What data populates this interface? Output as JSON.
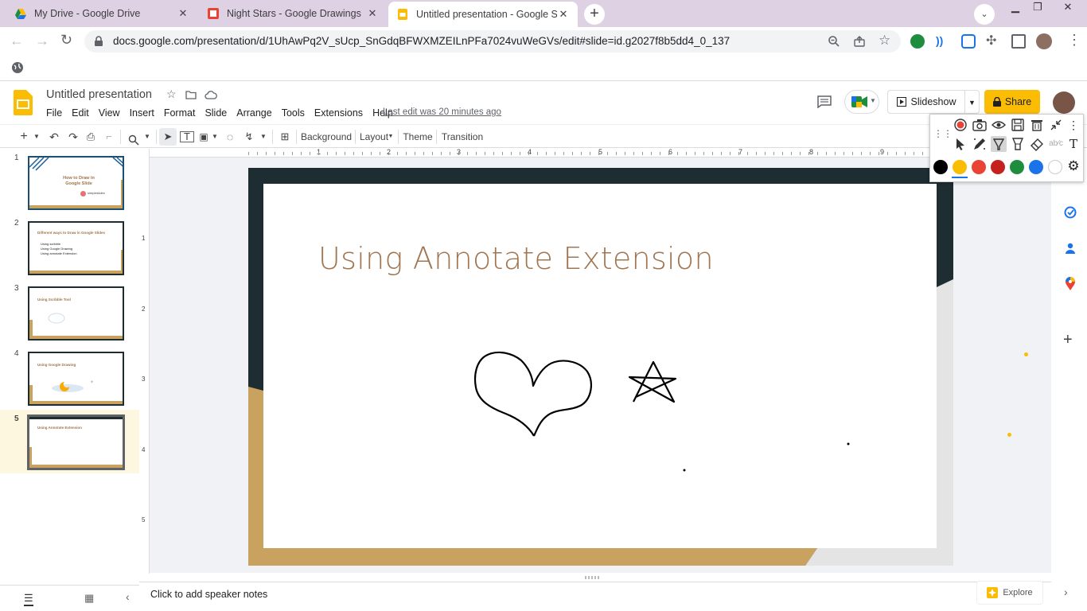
{
  "browser": {
    "tabs": [
      {
        "label": "My Drive - Google Drive",
        "icon": "google-drive-icon"
      },
      {
        "label": "Night Stars - Google Drawings",
        "icon": "google-drawings-icon"
      },
      {
        "label": "Untitled presentation - Google Sl",
        "icon": "google-slides-icon",
        "active": true
      }
    ],
    "new_tab": "+",
    "url": "docs.google.com/presentation/d/1UhAwPq2V_sUcp_SnGdqBFWXMZEILnPFa7024vuWeGVs/edit#slide=id.g2027f8b5dd4_0_137"
  },
  "app": {
    "doc_title": "Untitled presentation",
    "menus": [
      "File",
      "Edit",
      "View",
      "Insert",
      "Format",
      "Slide",
      "Arrange",
      "Tools",
      "Extensions",
      "Help"
    ],
    "last_edit": "Last edit was 20 minutes ago",
    "slideshow_label": "Slideshow",
    "share_label": "Share"
  },
  "toolbar": {
    "background": "Background",
    "layout": "Layout",
    "theme": "Theme",
    "transition": "Transition"
  },
  "ruler": {
    "h_ticks": [
      "1",
      "2",
      "3",
      "4",
      "5",
      "6",
      "7",
      "8",
      "9"
    ],
    "v_ticks": [
      "1",
      "2",
      "3",
      "4",
      "5"
    ]
  },
  "filmstrip": {
    "slides": [
      {
        "num": "1",
        "title": "How to Draw in Google Slide",
        "sub": "simpleslides"
      },
      {
        "num": "2",
        "title": "Different ways to Draw in Google Slides",
        "bullets": [
          "Using scribble",
          "Using Google Drawing",
          "Using annotate Extension"
        ]
      },
      {
        "num": "3",
        "title": "Using Scribble Tool"
      },
      {
        "num": "4",
        "title": "Using Google Drawing"
      },
      {
        "num": "5",
        "title": "Using Annotate Extension",
        "selected": true
      }
    ]
  },
  "slide": {
    "title": "Using Annotate Extension"
  },
  "notes": {
    "placeholder": "Click to add speaker notes"
  },
  "explore": {
    "label": "Explore"
  },
  "annotate_palette": {
    "colors": [
      "#000000",
      "#fbbc04",
      "#ea4335",
      "#c5221f",
      "#1e8e3e",
      "#1a73e8",
      "#ffffff"
    ]
  },
  "colors": {
    "accent": "#fbbc04",
    "slide_dark": "#1d2d32",
    "slide_gold": "#c9a25f",
    "title_brown": "#a07550"
  }
}
